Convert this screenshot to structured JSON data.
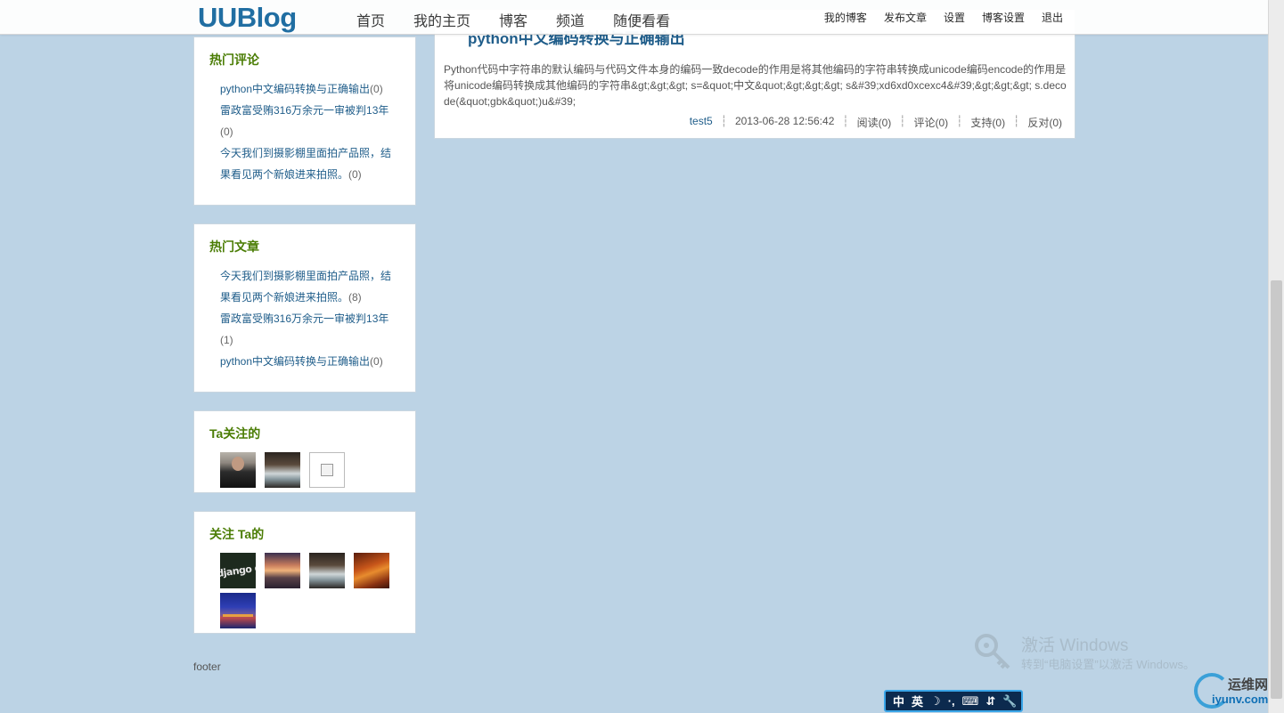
{
  "site": {
    "logo": "UUBlog",
    "main_nav": [
      "首页",
      "我的主页",
      "博客",
      "频道",
      "随便看看"
    ],
    "user_nav": [
      "我的博客",
      "发布文章",
      "设置",
      "博客设置",
      "退出"
    ]
  },
  "article": {
    "title": "python中文编码转换与正确输出",
    "body": "Python代码中字符串的默认编码与代码文件本身的编码一致decode的作用是将其他编码的字符串转换成unicode编码encode的作用是将unicode编码转换成其他编码的字符串&gt;&gt;&gt; s=&quot;中文&quot;&gt;&gt;&gt; s&#39;xd6xd0xcexc4&#39;&gt;&gt;&gt; s.decode(&quot;gbk&quot;)u&#39;",
    "author": "test5",
    "datetime": "2013-06-28 12:56:42",
    "read": "阅读(0)",
    "comments": "评论(0)",
    "support": "支持(0)",
    "oppose": "反对(0)"
  },
  "hot_comments": {
    "title": "热门评论",
    "items": [
      {
        "label": "python中文编码转换与正确输出",
        "count": "(0)"
      },
      {
        "label": "雷政富受贿316万余元一审被判13年",
        "count": "(0)"
      },
      {
        "label": "今天我们到摄影棚里面拍产品照，结果看见两个新娘进来拍照。",
        "count": "(0)"
      }
    ]
  },
  "hot_articles": {
    "title": "热门文章",
    "items": [
      {
        "label": "今天我们到摄影棚里面拍产品照，结果看见两个新娘进来拍照。",
        "count": "(8)"
      },
      {
        "label": "雷政富受贿316万余元一审被判13年",
        "count": "(1)"
      },
      {
        "label": "python中文编码转换与正确输出",
        "count": "(0)"
      }
    ]
  },
  "following": {
    "title": "Ta关注的"
  },
  "followers": {
    "title": "关注 Ta的",
    "django_avatar_text": "django china"
  },
  "footer": "footer",
  "windows_activation": {
    "line1": "激活 Windows",
    "line2": "转到“电脑设置”以激活 Windows。"
  },
  "ime": {
    "items": [
      "中",
      "英",
      "☽",
      "·,",
      "⌨",
      "⇵",
      "🔧"
    ]
  },
  "watermark": {
    "cn": "运维网",
    "en": "iyunv.com"
  }
}
